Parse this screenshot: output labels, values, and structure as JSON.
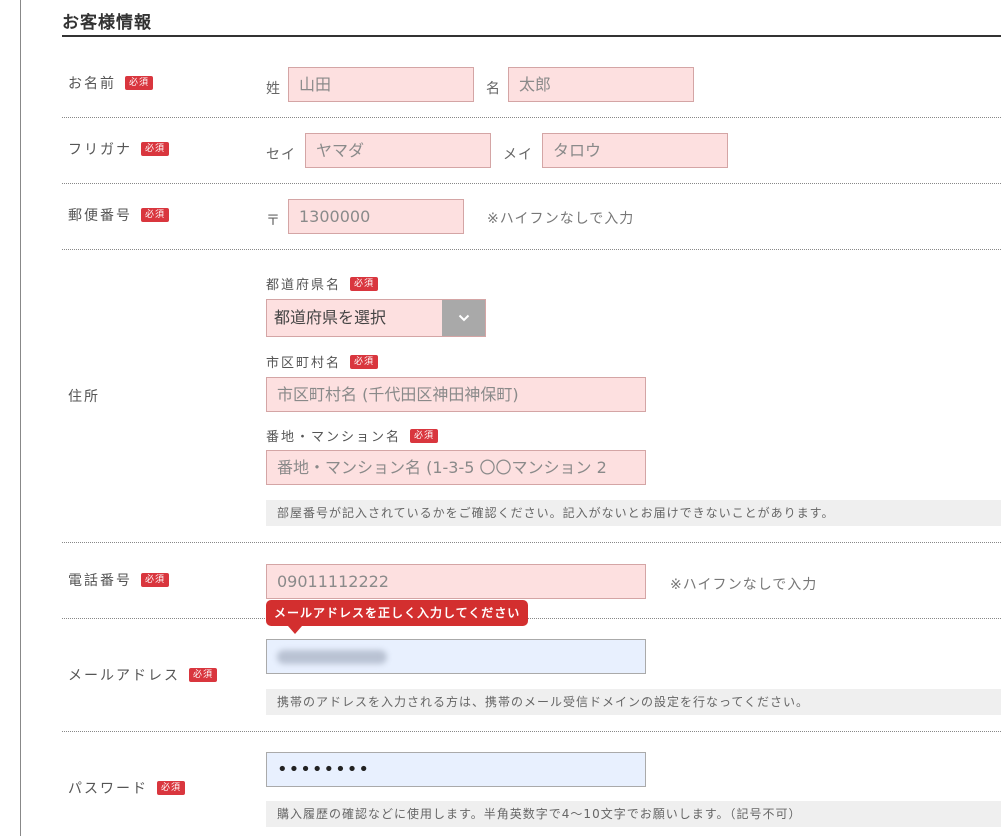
{
  "section": {
    "title": "お客様情報"
  },
  "required_badge": "必須",
  "name": {
    "label": "お名前",
    "last_prefix": "姓",
    "last_placeholder": "山田",
    "first_prefix": "名",
    "first_placeholder": "太郎"
  },
  "furigana": {
    "label": "フリガナ",
    "last_prefix": "セイ",
    "last_placeholder": "ヤマダ",
    "first_prefix": "メイ",
    "first_placeholder": "タロウ"
  },
  "postal": {
    "label": "郵便番号",
    "prefix": "〒",
    "placeholder": "1300000",
    "hint": "※ハイフンなしで入力"
  },
  "address": {
    "label": "住所",
    "prefecture_label": "都道府県名",
    "prefecture_selected": "都道府県を選択",
    "city_label": "市区町村名",
    "city_placeholder": "市区町村名 (千代田区神田神保町)",
    "street_label": "番地・マンション名",
    "street_placeholder": "番地・マンション名 (1-3-5 〇〇マンション 2",
    "note": "部屋番号が記入されているかをご確認ください。記入がないとお届けできないことがあります。"
  },
  "phone": {
    "label": "電話番号",
    "placeholder": "09011112222",
    "hint": "※ハイフンなしで入力"
  },
  "email": {
    "label": "メールアドレス",
    "error": "メールアドレスを正しく入力してください",
    "note": "携帯のアドレスを入力される方は、携帯のメール受信ドメインの設定を行なってください。"
  },
  "password": {
    "label": "パスワード",
    "value": "••••••••",
    "note": "購入履歴の確認などに使用します。半角英数字で4〜10文字でお願いします。（記号不可）"
  },
  "colors": {
    "required": "#d9363e",
    "input_bg": "#fde0e0",
    "error": "#d32f2f",
    "autofill": "#e8f0fe"
  },
  "icons": {
    "select_arrow": "chevron-down-icon"
  }
}
